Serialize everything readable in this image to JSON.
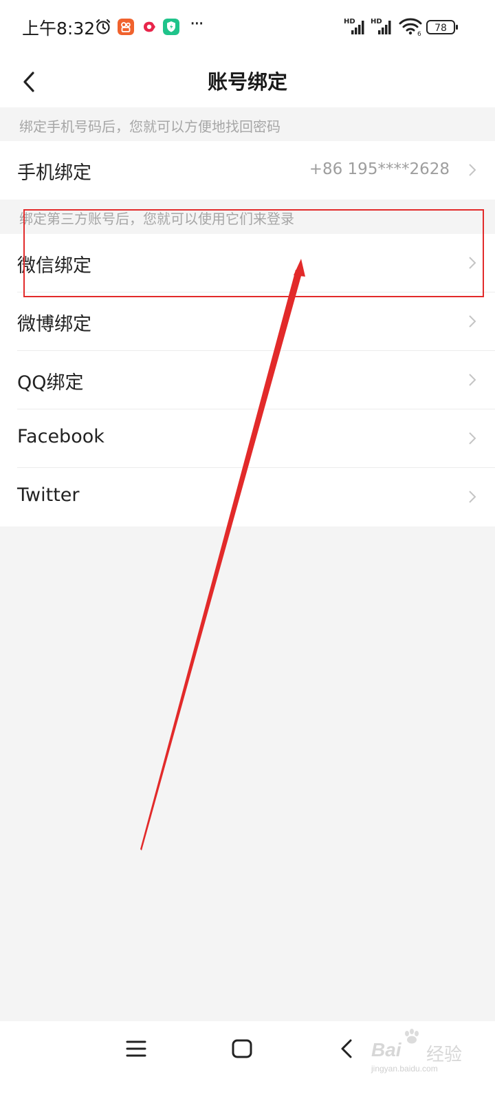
{
  "status_bar": {
    "time": "上午8:32",
    "app_icons": [
      "alarm-icon",
      "kuaishou-icon",
      "red-app-icon",
      "security-app-icon"
    ],
    "more": "···",
    "net_badge_1": "HD",
    "net_badge_2": "HD",
    "wifi_sub": "6",
    "battery": "78"
  },
  "header": {
    "title": "账号绑定"
  },
  "sections": {
    "phone_hint": "绑定手机号码后，您就可以方便地找回密码",
    "thirdparty_hint": "绑定第三方账号后，您就可以使用它们来登录"
  },
  "rows": [
    {
      "label": "手机绑定",
      "value": "+86 195****2628"
    },
    {
      "label": "微信绑定",
      "value": ""
    },
    {
      "label": "微博绑定",
      "value": ""
    },
    {
      "label": "QQ绑定",
      "value": ""
    },
    {
      "label": "Facebook",
      "value": ""
    },
    {
      "label": "Twitter",
      "value": ""
    }
  ],
  "watermark": {
    "brand_left": "Bai",
    "brand_right": "经验",
    "url": "jingyan.baidu.com"
  },
  "colors": {
    "annotation": "#e22a2a",
    "app_orange": "#f0622d",
    "app_red": "#e8254a",
    "app_green": "#1fc38a"
  }
}
